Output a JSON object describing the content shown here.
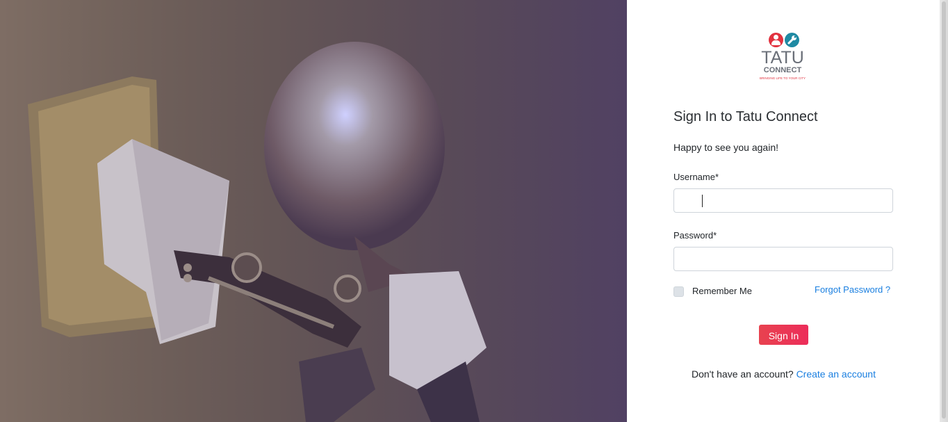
{
  "hero": {
    "image": "light-bulb-robot-plugging-into-wall-socket"
  },
  "logo": {
    "icons": [
      "user-icon",
      "wrench-icon"
    ],
    "word": "TATU",
    "sub": "CONNECT",
    "tagline": "BRINGING LIFE TO YOUR CITY"
  },
  "form": {
    "title": "Sign In to Tatu Connect",
    "greeting": "Happy to see you again!",
    "username_label": "Username*",
    "username_value": "",
    "password_label": "Password*",
    "password_value": "",
    "remember_label": "Remember Me",
    "forgot_label": "Forgot Password ?",
    "signin_label": "Sign In",
    "no_account_text": "Don't have an account?",
    "create_account_label": "Create an account"
  },
  "colors": {
    "accent": "#ec2d5a",
    "link": "#1a7fe0",
    "logo_red": "#e2323f",
    "logo_teal": "#1f8aa3"
  }
}
